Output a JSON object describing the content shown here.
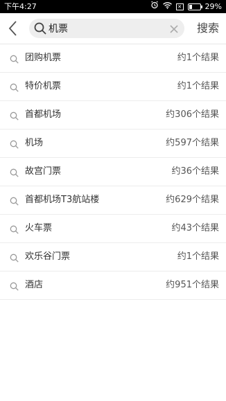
{
  "status_bar": {
    "time": "下午4:27",
    "battery_percent": "29%",
    "battery_level": 0.29,
    "icons": [
      "alarm-icon",
      "wifi-icon",
      "sim-icon",
      "battery-icon"
    ]
  },
  "header": {
    "back_icon": "chevron-left-icon",
    "search": {
      "value": "机票",
      "icon": "search-icon",
      "clear_icon": "clear-icon"
    },
    "action_label": "搜索"
  },
  "suggestions": [
    {
      "label": "团购机票",
      "count": "约1个结果"
    },
    {
      "label": "特价机票",
      "count": "约1个结果"
    },
    {
      "label": "首都机场",
      "count": "约306个结果"
    },
    {
      "label": "机场",
      "count": "约597个结果"
    },
    {
      "label": "故宫门票",
      "count": "约36个结果"
    },
    {
      "label": "首都机场T3航站楼",
      "count": "约629个结果"
    },
    {
      "label": "火车票",
      "count": "约43个结果"
    },
    {
      "label": "欢乐谷门票",
      "count": "约1个结果"
    },
    {
      "label": "酒店",
      "count": "约951个结果"
    }
  ],
  "colors": {
    "status_bar_bg": "#000000",
    "search_bg": "#eeeeee",
    "divider": "#ececec",
    "text_primary": "#333333"
  }
}
